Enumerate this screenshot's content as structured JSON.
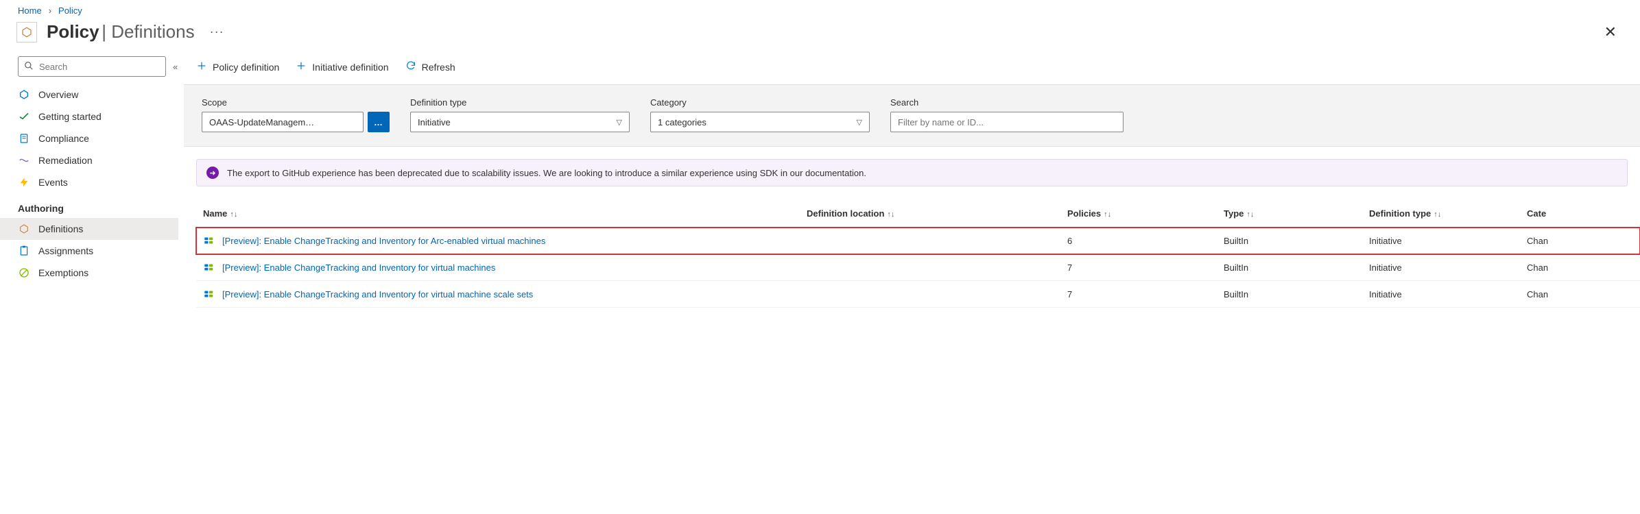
{
  "breadcrumb": {
    "home": "Home",
    "policy": "Policy"
  },
  "header": {
    "title_bold": "Policy",
    "title_rest": "Definitions"
  },
  "sidebar": {
    "search_placeholder": "Search",
    "items": {
      "overview": "Overview",
      "getting_started": "Getting started",
      "compliance": "Compliance",
      "remediation": "Remediation",
      "events": "Events"
    },
    "section": "Authoring",
    "authoring": {
      "definitions": "Definitions",
      "assignments": "Assignments",
      "exemptions": "Exemptions"
    }
  },
  "toolbar": {
    "policy_def": "Policy definition",
    "initiative_def": "Initiative definition",
    "refresh": "Refresh"
  },
  "filters": {
    "scope_label": "Scope",
    "scope_value": "OAAS-UpdateManagem…",
    "deftype_label": "Definition type",
    "deftype_value": "Initiative",
    "category_label": "Category",
    "category_value": "1 categories",
    "search_label": "Search",
    "search_placeholder": "Filter by name or ID..."
  },
  "banner": {
    "text": "The export to GitHub experience has been deprecated due to scalability issues. We are looking to introduce a similar experience using SDK in our documentation."
  },
  "columns": {
    "name": "Name",
    "location": "Definition location",
    "policies": "Policies",
    "type": "Type",
    "deftype": "Definition type",
    "category": "Cate"
  },
  "rows": [
    {
      "name": "[Preview]: Enable ChangeTracking and Inventory for Arc-enabled virtual machines",
      "location": "",
      "policies": "6",
      "type": "BuiltIn",
      "deftype": "Initiative",
      "category": "Chan",
      "highlight": true
    },
    {
      "name": "[Preview]: Enable ChangeTracking and Inventory for virtual machines",
      "location": "",
      "policies": "7",
      "type": "BuiltIn",
      "deftype": "Initiative",
      "category": "Chan",
      "highlight": false
    },
    {
      "name": "[Preview]: Enable ChangeTracking and Inventory for virtual machine scale sets",
      "location": "",
      "policies": "7",
      "type": "BuiltIn",
      "deftype": "Initiative",
      "category": "Chan",
      "highlight": false
    }
  ]
}
